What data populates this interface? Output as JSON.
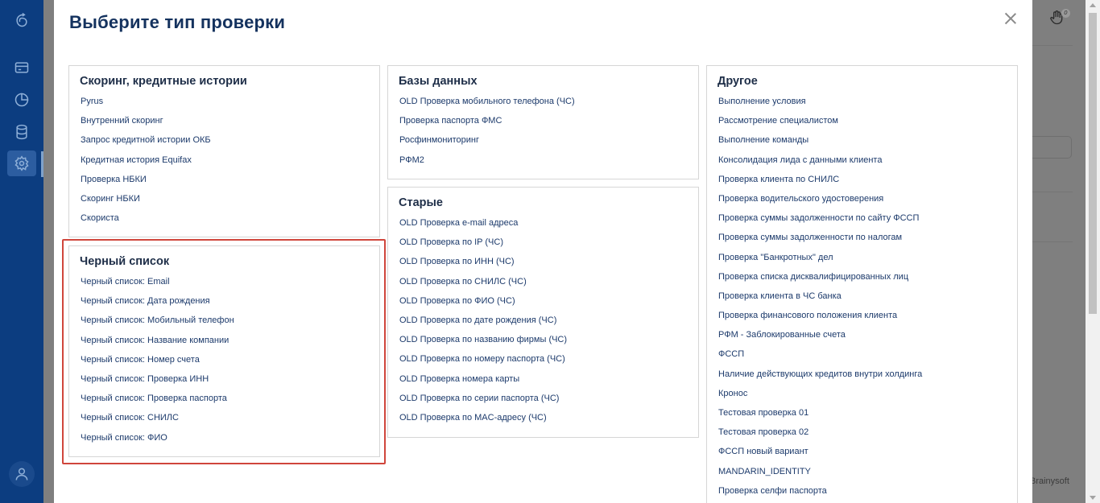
{
  "modal": {
    "title": "Выберите тип проверки"
  },
  "cards": {
    "scoring": {
      "title": "Скоринг, кредитные истории",
      "items": [
        "Pyrus",
        "Внутренний скоринг",
        "Запрос кредитной истории ОКБ",
        "Кредитная история Equifax",
        "Проверка НБКИ",
        "Скоринг НБКИ",
        "Скориста"
      ]
    },
    "blacklist": {
      "title": "Черный список",
      "items": [
        "Черный список: Email",
        "Черный список: Дата рождения",
        "Черный список: Мобильный телефон",
        "Черный список: Название компании",
        "Черный список: Номер счета",
        "Черный список: Проверка ИНН",
        "Черный список: Проверка паспорта",
        "Черный список: СНИЛС",
        "Черный список: ФИО"
      ]
    },
    "databases": {
      "title": "Базы данных",
      "items": [
        "OLD Проверка мобильного телефона (ЧС)",
        "Проверка паспорта ФМС",
        "Росфинмониторинг",
        "РФМ2"
      ]
    },
    "old": {
      "title": "Старые",
      "items": [
        "OLD Проверка e-mail адреса",
        "OLD Проверка по IP (ЧС)",
        "OLD Проверка по ИНН (ЧС)",
        "OLD Проверка по СНИЛС (ЧС)",
        "OLD Проверка по ФИО (ЧС)",
        "OLD Проверка по дате рождения (ЧС)",
        "OLD Проверка по названию фирмы (ЧС)",
        "OLD Проверка по номеру паспорта (ЧС)",
        "OLD Проверка номера карты",
        "OLD Проверка по серии паспорта (ЧС)",
        "OLD Проверка по MAC-адресу (ЧС)"
      ]
    },
    "other": {
      "title": "Другое",
      "items": [
        "Выполнение условия",
        "Рассмотрение специалистом",
        "Выполнение команды",
        "Консолидация лида с данными клиента",
        "Проверка клиента по СНИЛС",
        "Проверка водительского удостоверения",
        "Проверка суммы задолженности по сайту ФССП",
        "Проверка суммы задолженности по налогам",
        "Проверка \"Банкротных\" дел",
        "Проверка списка дисквалифицированных лиц",
        "Проверка клиента в ЧС банка",
        "Проверка финансового положения клиента",
        "РФМ - Заблокированные счета",
        "ФССП",
        "Наличие действующих кредитов внутри холдинга",
        "Кронос",
        "Тестовая проверка 01",
        "Тестовая проверка 02",
        "ФССП новый вариант",
        "MANDARIN_IDENTITY",
        "Проверка селфи паспорта"
      ]
    }
  },
  "background": {
    "brand": "Brainysoft",
    "notifications_count": "0"
  },
  "colors": {
    "sidebar": "#0c3d80",
    "title": "#14325e",
    "link": "#1c3a6b",
    "highlight": "#d0463c"
  }
}
